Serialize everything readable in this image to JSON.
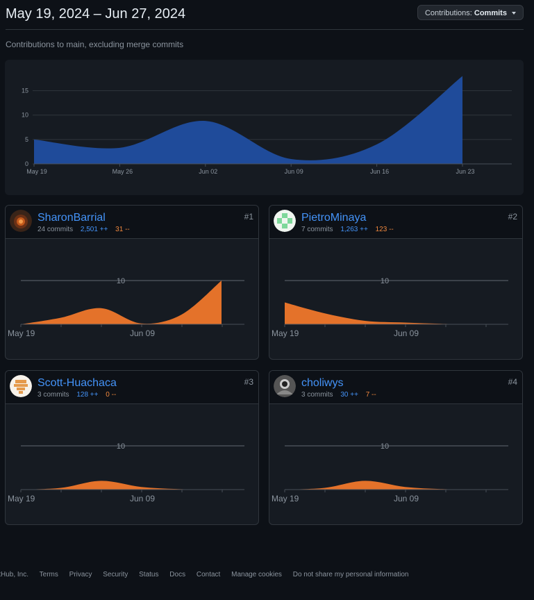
{
  "header": {
    "title": "May 19, 2024 – Jun 27, 2024",
    "dropdown_prefix": "Contributions:",
    "dropdown_value": "Commits"
  },
  "subtitle": "Contributions to main, excluding merge commits",
  "colors": {
    "main_area": "#1f4b9a",
    "user_area": "#e4722a",
    "link": "#4493f8",
    "deletions": "#f0883e"
  },
  "chart_data": [
    {
      "type": "area",
      "x": [
        "May 19",
        "May 26",
        "Jun 02",
        "Jun 09",
        "Jun 16",
        "Jun 23"
      ],
      "values": [
        5,
        3.3,
        8.8,
        1,
        4,
        18
      ],
      "tick_labels_x": [
        "May 19",
        "May 26",
        "Jun 02",
        "Jun 09",
        "Jun 16",
        "Jun 23"
      ],
      "tick_labels_y": [
        "0",
        "5",
        "10",
        "15"
      ],
      "ylim": [
        0,
        19.5
      ],
      "grid": true
    },
    {
      "type": "area",
      "user": "SharonBarrial",
      "values": [
        0,
        1.5,
        3.7,
        0.2,
        2.2,
        10
      ],
      "tick_labels_x": [
        "May 19",
        "Jun 09"
      ],
      "tick_labels_y": [
        "10"
      ],
      "ylim": [
        0,
        10
      ]
    },
    {
      "type": "area",
      "user": "PietroMinaya",
      "values": [
        5,
        2.5,
        0.8,
        0.4,
        0.1,
        0
      ],
      "tick_labels_x": [
        "May 19",
        "Jun 09"
      ],
      "tick_labels_y": [
        "10"
      ],
      "ylim": [
        0,
        10
      ]
    },
    {
      "type": "area",
      "user": "Scott-Huachaca",
      "values": [
        0,
        0.4,
        2.0,
        0.6,
        0.1,
        0
      ],
      "tick_labels_x": [
        "May 19",
        "Jun 09"
      ],
      "tick_labels_y": [
        "10"
      ],
      "ylim": [
        0,
        10
      ]
    },
    {
      "type": "area",
      "user": "choliwys",
      "values": [
        0,
        0.4,
        2.0,
        0.6,
        0.1,
        0
      ],
      "tick_labels_x": [
        "May 19",
        "Jun 09"
      ],
      "tick_labels_y": [
        "10"
      ],
      "ylim": [
        0,
        10
      ]
    }
  ],
  "contributors": [
    {
      "name": "SharonBarrial",
      "commits": "24 commits",
      "additions": "2,501 ++",
      "deletions": "31 --",
      "rank": "#1",
      "avatar": "avatar-photo-icon"
    },
    {
      "name": "PietroMinaya",
      "commits": "7 commits",
      "additions": "1,263 ++",
      "deletions": "123 --",
      "rank": "#2",
      "avatar": "identicon-green-icon"
    },
    {
      "name": "Scott-Huachaca",
      "commits": "3 commits",
      "additions": "128 ++",
      "deletions": "0 --",
      "rank": "#3",
      "avatar": "identicon-orange-icon"
    },
    {
      "name": "choliwys",
      "commits": "3 commits",
      "additions": "30 ++",
      "deletions": "7 --",
      "rank": "#4",
      "avatar": "avatar-photo-icon"
    }
  ],
  "footer": {
    "links": [
      "itHub, Inc.",
      "Terms",
      "Privacy",
      "Security",
      "Status",
      "Docs",
      "Contact",
      "Manage cookies",
      "Do not share my personal information"
    ]
  }
}
